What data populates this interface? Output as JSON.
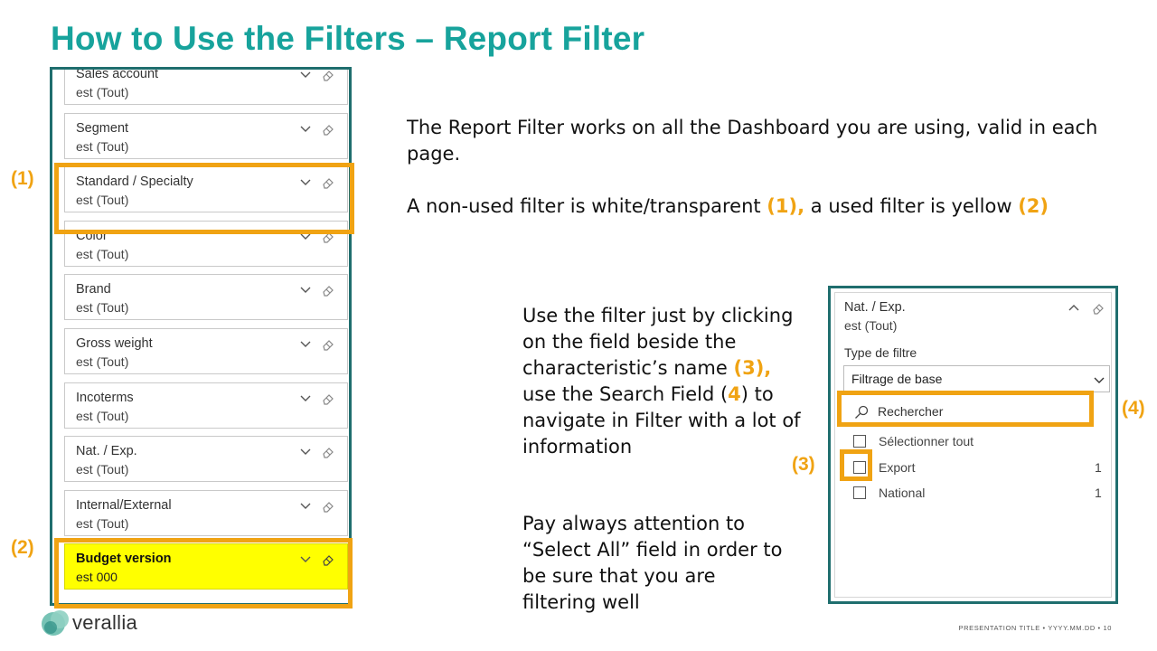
{
  "slide": {
    "title": "How to Use the Filters – Report Filter",
    "paragraph1": "The Report Filter works on all the Dashboard you are using, valid in each page.",
    "paragraph2": {
      "part1": "A non-used filter is white/transparent ",
      "marker1": "(1),",
      "part2": " a used filter is yellow ",
      "marker2": "(2)"
    },
    "paragraph3": {
      "part1": "Use the filter just by clicking on the field beside the characteristic’s name ",
      "marker3": "(3),",
      "part2": " use the Search Field ",
      "marker4_open": "(",
      "marker4": "4",
      "marker4_close": ")",
      "part3": " to navigate in Filter with a lot of information"
    },
    "paragraph4": "Pay always attention to “Select All” field in order to be sure that you are filtering well",
    "markers": {
      "m1": "(1)",
      "m2": "(2)",
      "m3": "(3)",
      "m4": "(4)"
    },
    "footer": "PRESENTATION TITLE  •  YYYY.MM.DD  •  10",
    "logo_text": "verallia"
  },
  "left_filters": [
    {
      "name": "Sales account",
      "value": "est (Tout)",
      "used": false
    },
    {
      "name": "Segment",
      "value": "est (Tout)",
      "used": false
    },
    {
      "name": "Standard / Specialty",
      "value": "est (Tout)",
      "used": false
    },
    {
      "name": "Color",
      "value": "est (Tout)",
      "used": false
    },
    {
      "name": "Brand",
      "value": "est (Tout)",
      "used": false
    },
    {
      "name": "Gross weight",
      "value": "est (Tout)",
      "used": false
    },
    {
      "name": "Incoterms",
      "value": "est (Tout)",
      "used": false
    },
    {
      "name": "Nat. / Exp.",
      "value": "est (Tout)",
      "used": false
    },
    {
      "name": "Internal/External",
      "value": "est (Tout)",
      "used": false
    },
    {
      "name": "Budget version",
      "value": "est 000",
      "used": true
    }
  ],
  "expanded_filter": {
    "name": "Nat. / Exp.",
    "value": "est (Tout)",
    "filter_type_label": "Type de filtre",
    "filter_type_selected": "Filtrage de base",
    "search_placeholder": "Rechercher",
    "select_all_label": "Sélectionner tout",
    "options": [
      {
        "label": "Export",
        "count": "1"
      },
      {
        "label": "National",
        "count": "1"
      }
    ]
  },
  "colors": {
    "title": "#17a39c",
    "panel_border": "#1f6e6e",
    "highlight": "#f0a313",
    "used_filter": "#ffff00",
    "logo": "#5fb8a8"
  },
  "icons": {
    "chevron": "chevron-down-icon",
    "eraser": "eraser-icon",
    "search": "search-icon",
    "logo": "verallia-logo-icon"
  }
}
